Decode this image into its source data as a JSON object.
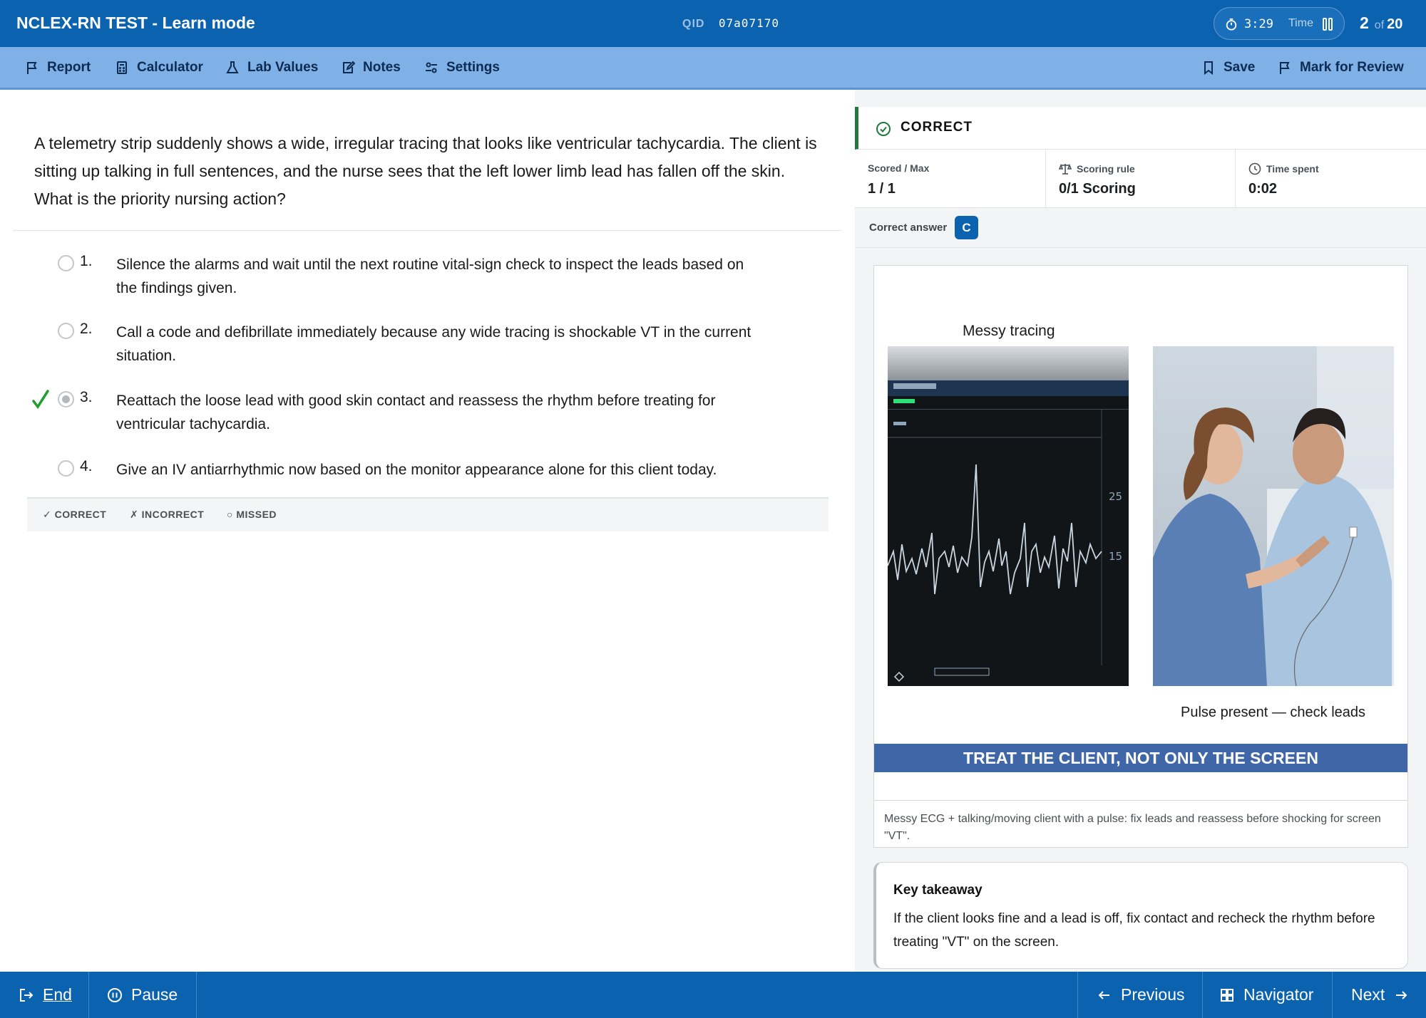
{
  "header": {
    "title": "NCLEX-RN TEST - Learn mode",
    "qid_label": "QID",
    "qid_value": "07a07170",
    "timer_value": "3:29",
    "timer_label": "Time",
    "question_current": "2",
    "question_of": "of",
    "question_total": "20"
  },
  "toolbar": {
    "report": "Report",
    "calculator": "Calculator",
    "lab_values": "Lab Values",
    "notes": "Notes",
    "settings": "Settings",
    "save": "Save",
    "mark_for_review": "Mark for Review"
  },
  "question": {
    "stem": "A telemetry strip suddenly shows a wide, irregular tracing that looks like ventricular tachycardia. The client is sitting up talking in full sentences, and the nurse sees that the left lower limb lead has fallen off the skin. What is the priority nursing action?",
    "options": [
      {
        "number": "1.",
        "text": "Silence the alarms and wait until the next routine vital-sign check to inspect the leads based on the findings given.",
        "selected": false,
        "correct": false
      },
      {
        "number": "2.",
        "text": "Call a code and defibrillate immediately because any wide tracing is shockable VT in the current situation.",
        "selected": false,
        "correct": false
      },
      {
        "number": "3.",
        "text": "Reattach the loose lead with good skin contact and reassess the rhythm before treating for ventricular tachycardia.",
        "selected": true,
        "correct": true
      },
      {
        "number": "4.",
        "text": "Give an IV antiarrhythmic now based on the monitor appearance alone for this client today.",
        "selected": false,
        "correct": false
      }
    ],
    "legend": {
      "correct": "✓ CORRECT",
      "incorrect": "✗ INCORRECT",
      "missed": "○ MISSED"
    }
  },
  "result": {
    "status": "CORRECT",
    "scored_label": "Scored / Max",
    "scored_value": "1 / 1",
    "rule_label": "Scoring rule",
    "rule_value": "0/1 Scoring",
    "time_label": "Time spent",
    "time_value": "0:02",
    "answer_label": "Correct answer",
    "answer_value": "C",
    "status_color": "#1f7a3c"
  },
  "figure": {
    "caption_left": "Messy tracing",
    "caption_right": "Pulse present — check leads",
    "banner": "TREAT THE CLIENT, NOT ONLY THE SCREEN",
    "note": "Messy ECG + talking/moving client with a pulse: fix leads and reassess before shocking for screen \"VT\"."
  },
  "takeaway": {
    "title": "Key takeaway",
    "body": "If the client looks fine and a lead is off, fix contact and recheck the rhythm before treating \"VT\" on the screen."
  },
  "footer": {
    "end": "End",
    "pause": "Pause",
    "previous": "Previous",
    "navigator": "Navigator",
    "next": "Next"
  },
  "colors": {
    "header_blue": "#0b62ae",
    "toolbar_blue": "#7fb1e6",
    "correct_green": "#1f9d2e"
  }
}
